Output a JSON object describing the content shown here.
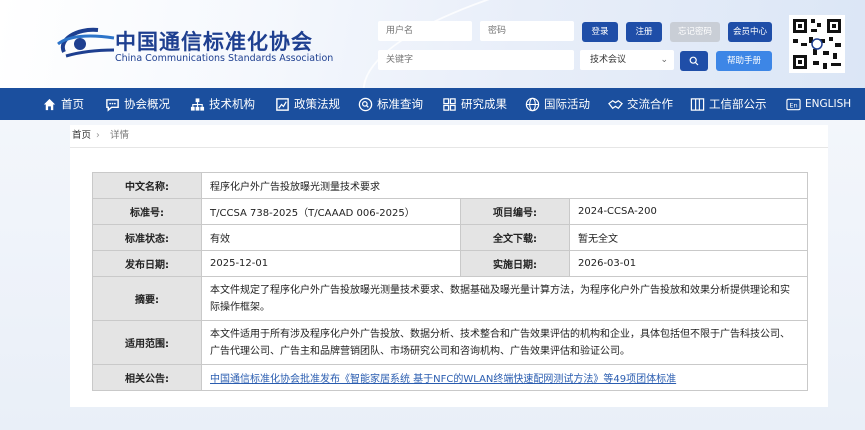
{
  "header": {
    "org_cn": "中国通信标准化协会",
    "org_en": "China Communications Standards Association",
    "username_placeholder": "用户名",
    "password_placeholder": "密码",
    "keyword_placeholder": "关键字",
    "login_label": "登录",
    "register_label": "注册",
    "forgot_label": "忘记密码",
    "member_center_label": "会员中心",
    "category_selected": "技术会议",
    "help_label": "帮助手册"
  },
  "nav": {
    "items": [
      {
        "label": "首页",
        "icon": "home-icon"
      },
      {
        "label": "协会概况",
        "icon": "chat-icon"
      },
      {
        "label": "技术机构",
        "icon": "org-icon"
      },
      {
        "label": "政策法规",
        "icon": "book-icon"
      },
      {
        "label": "标准查询",
        "icon": "search-circle-icon"
      },
      {
        "label": "研究成果",
        "icon": "grid-icon"
      },
      {
        "label": "国际活动",
        "icon": "globe-icon"
      },
      {
        "label": "交流合作",
        "icon": "handshake-icon"
      },
      {
        "label": "工信部公示",
        "icon": "columns-icon"
      },
      {
        "label": "ENGLISH",
        "icon": "en-icon"
      }
    ]
  },
  "breadcrumb": {
    "home": "首页",
    "separator": "›",
    "current": "详情"
  },
  "detail": {
    "cn_name_label": "中文名称:",
    "cn_name": "程序化户外广告投放曝光测量技术要求",
    "std_no_label": "标准号:",
    "std_no": "T/CCSA 738-2025（T/CAAAD 006-2025）",
    "project_no_label": "项目编号:",
    "project_no": "2024-CCSA-200",
    "status_label": "标准状态:",
    "status": "有效",
    "fulltext_label": "全文下载:",
    "fulltext": "暂无全文",
    "publish_label": "发布日期:",
    "publish_date": "2025-12-01",
    "impl_label": "实施日期:",
    "impl_date": "2026-03-01",
    "abstract_label": "摘要:",
    "abstract": "本文件规定了程序化户外广告投放曝光测量技术要求、数据基础及曝光量计算方法，为程序化户外广告投放和效果分析提供理论和实际操作框架。",
    "scope_label": "适用范围:",
    "scope": "本文件适用于所有涉及程序化户外广告投放、数据分析、技术整合和广告效果评估的机构和企业，具体包括但不限于广告科技公司、广告代理公司、广告主和品牌营销团队、市场研究公司和咨询机构、广告效果评估和验证公司。",
    "notice_label": "相关公告:",
    "notice_link": "中国通信标准化协会批准发布《智能家居系统 基于NFC的WLAN终端快速配网测试方法》等49项团体标准"
  },
  "colors": {
    "nav_bg": "#1b4f9e",
    "brand": "#1e3f90",
    "link": "#2a5db0"
  }
}
